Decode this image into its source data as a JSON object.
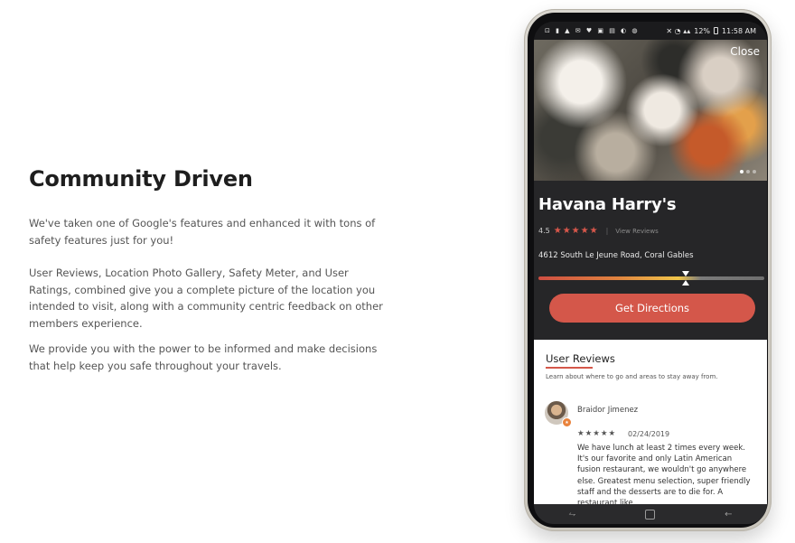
{
  "content": {
    "heading": "Community Driven",
    "paragraphs": [
      "We've taken one of Google's features and enhanced it with tons of safety features just for you!",
      "User Reviews, Location Photo Gallery, Safety Meter, and User Ratings, combined give you a complete picture of the location you intended to visit, along with a community centric feedback on other members experience.",
      "We provide you with the power to be informed and make decisions that help keep you safe throughout your travels."
    ]
  },
  "phone": {
    "status": {
      "icons": "⊡ ▮ ▲ ✉ ♥ ▣ ▤ ◐ ◍",
      "signal_icons": "✕ ◔ ▴▴",
      "battery": "12%",
      "time": "11:58 AM"
    },
    "close_label": "Close",
    "place": {
      "name": "Havana Harry's",
      "rating": "4.5",
      "stars": "★★★★★",
      "view_reviews": "View Reviews",
      "address": "4612 South Le Jeune Road, Coral Gables",
      "safety_meter": 0.65,
      "directions_label": "Get Directions"
    },
    "reviews": {
      "title": "User Reviews",
      "subtitle": "Learn about where to go and areas to stay away from.",
      "items": [
        {
          "name": "Braidor Jimenez",
          "stars": "★★★★★",
          "date": "02/24/2019",
          "text": "We have lunch at least 2 times every week. It's our favorite and only Latin American fusion restaurant, we wouldn't go anywhere else. Greatest menu selection, super friendly staff and the desserts are to die for. A restaurant like"
        }
      ]
    },
    "nav": {
      "recent": "⥊",
      "back": "←"
    }
  },
  "colors": {
    "accent": "#d4574a",
    "dark_panel": "#262628"
  }
}
